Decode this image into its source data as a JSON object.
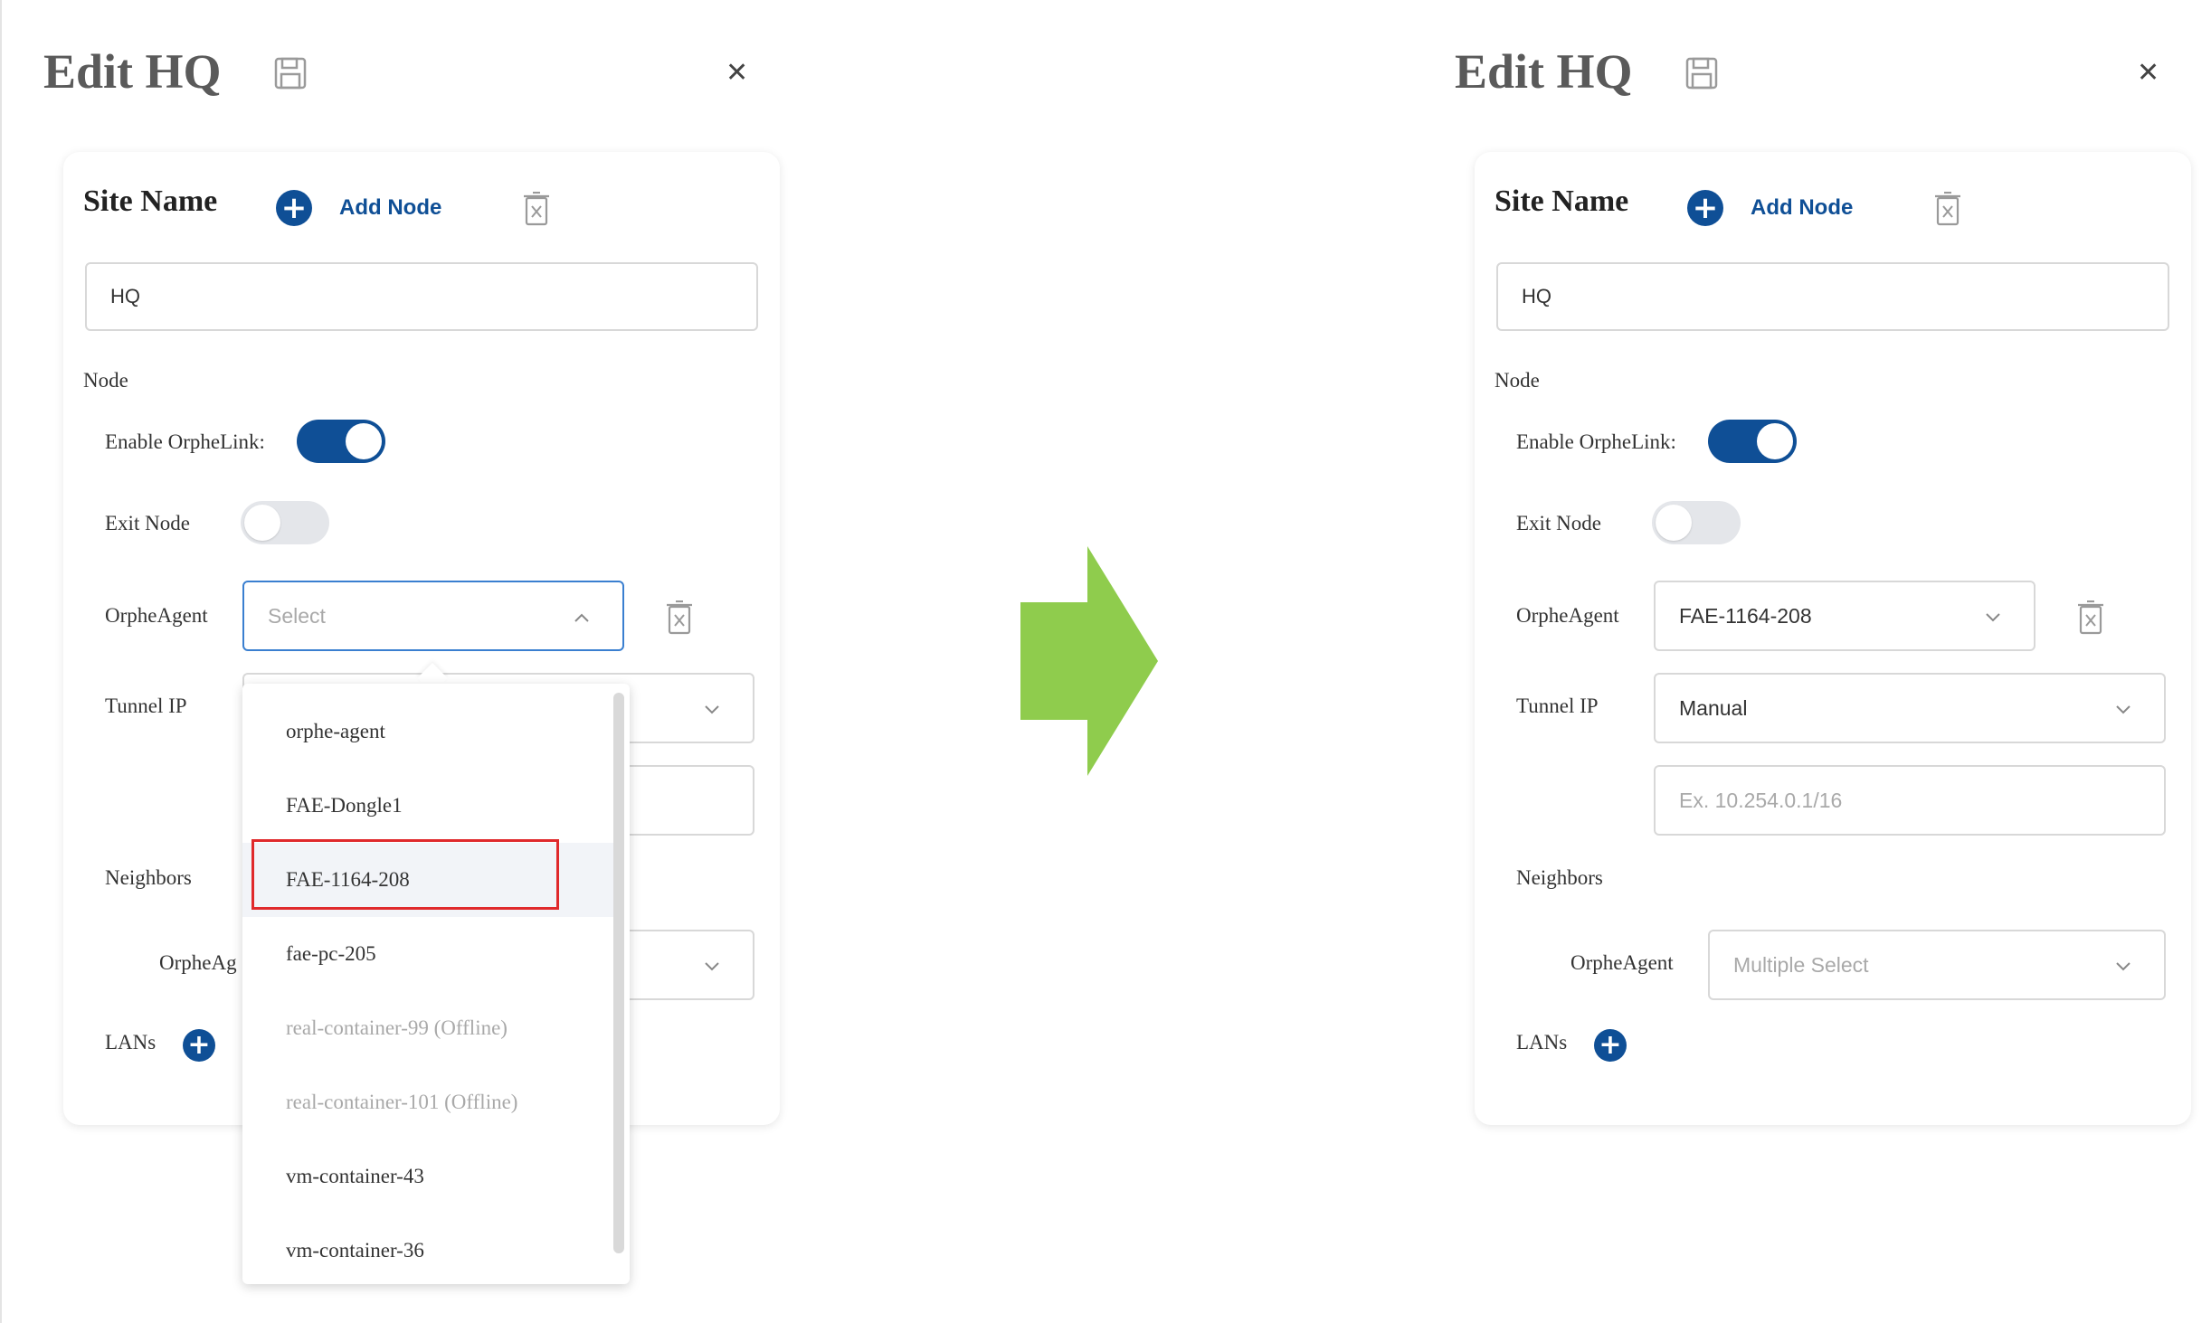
{
  "left": {
    "title": "Edit HQ",
    "site_name_label": "Site Name",
    "add_node_label": "Add Node",
    "site_name_value": "HQ",
    "node_label": "Node",
    "enable_orphelink_label": "Enable OrpheLink:",
    "enable_orphelink_on": true,
    "exit_node_label": "Exit Node",
    "exit_node_on": false,
    "orpheagent_label": "OrpheAgent",
    "orpheagent_placeholder": "Select",
    "tunnel_ip_label": "Tunnel IP",
    "neighbors_label": "Neighbors",
    "neighbors_agent_label": "OrpheAg",
    "lans_label": "LANs",
    "dropdown_options": [
      {
        "label": "orphe-agent",
        "offline": false
      },
      {
        "label": "FAE-Dongle1",
        "offline": false
      },
      {
        "label": "FAE-1164-208",
        "offline": false
      },
      {
        "label": "fae-pc-205",
        "offline": false
      },
      {
        "label": "real-container-99 (Offline)",
        "offline": true
      },
      {
        "label": "real-container-101 (Offline)",
        "offline": true
      },
      {
        "label": "vm-container-43",
        "offline": false
      },
      {
        "label": "vm-container-36",
        "offline": false
      }
    ]
  },
  "right": {
    "title": "Edit HQ",
    "site_name_label": "Site Name",
    "add_node_label": "Add Node",
    "site_name_value": "HQ",
    "node_label": "Node",
    "enable_orphelink_label": "Enable OrpheLink:",
    "enable_orphelink_on": true,
    "exit_node_label": "Exit Node",
    "exit_node_on": false,
    "orpheagent_label": "OrpheAgent",
    "orpheagent_value": "FAE-1164-208",
    "tunnel_ip_label": "Tunnel IP",
    "tunnel_ip_mode": "Manual",
    "tunnel_ip_placeholder": "Ex. 10.254.0.1/16",
    "neighbors_label": "Neighbors",
    "neighbors_agent_label": "OrpheAgent",
    "neighbors_placeholder": "Multiple Select",
    "lans_label": "LANs"
  },
  "colors": {
    "accent": "#0f4f96",
    "arrow": "#8fcc4d",
    "highlight": "#e0292b",
    "placeholder": "#a9a9a9"
  }
}
